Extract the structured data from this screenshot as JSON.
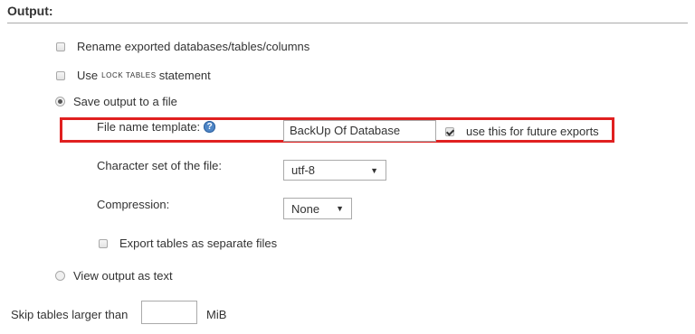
{
  "output": {
    "title": "Output:",
    "rename_label": "Rename exported databases/tables/columns",
    "use_label": "Use",
    "lock_tables_label": "LOCK TABLES",
    "statement_label": "statement",
    "save_to_file_label": "Save output to a file",
    "file_name_template_label": "File name template:",
    "help_icon_glyph": "?",
    "file_name_value": "BackUp Of Database",
    "future_exports_label": "use this for future exports",
    "future_exports_checked": true,
    "charset_label": "Character set of the file:",
    "charset_value": "utf-8",
    "compression_label": "Compression:",
    "compression_value": "None",
    "separate_files_label": "Export tables as separate files",
    "view_as_text_label": "View output as text",
    "skip_tables_label": "Skip tables larger than",
    "skip_tables_value": "",
    "skip_tables_unit": "MiB",
    "selected_output": "Save output to a file"
  },
  "colors": {
    "highlight_border": "#e02020",
    "help_icon": "#4f86c6"
  }
}
